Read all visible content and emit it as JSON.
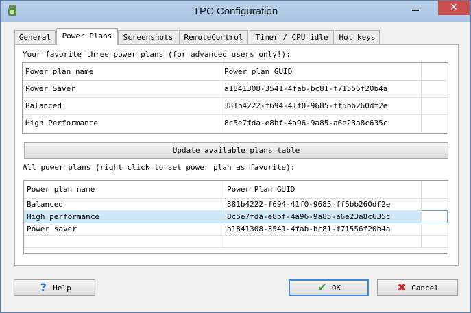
{
  "window": {
    "title": "TPC Configuration",
    "close_glyph": "✕"
  },
  "tabs": [
    {
      "label": "General"
    },
    {
      "label": "Power Plans"
    },
    {
      "label": "Screenshots"
    },
    {
      "label": "RemoteControl"
    },
    {
      "label": "Timer / CPU idle"
    },
    {
      "label": "Hot keys"
    }
  ],
  "favorites": {
    "caption": "Your favorite three power plans (for advanced users only!):",
    "headers": {
      "name": "Power plan name",
      "guid": "Power plan GUID"
    },
    "rows": [
      {
        "name": "Power Saver",
        "guid": "a1841308-3541-4fab-bc81-f71556f20b4a"
      },
      {
        "name": "Balanced",
        "guid": "381b4222-f694-41f0-9685-ff5bb260df2e"
      },
      {
        "name": "High Performance",
        "guid": "8c5e7fda-e8bf-4a96-9a85-a6e23a8c635c"
      }
    ]
  },
  "update_button": {
    "label": "Update available plans table"
  },
  "all_plans": {
    "caption": "All power plans (right click to set power plan as favorite):",
    "headers": {
      "name": "Power plan name",
      "guid": "Power Plan GUID"
    },
    "rows": [
      {
        "name": "Balanced",
        "guid": "381b4222-f694-41f0-9685-ff5bb260df2e"
      },
      {
        "name": "High performance",
        "guid": "8c5e7fda-e8bf-4a96-9a85-a6e23a8c635c",
        "selected": true
      },
      {
        "name": "Power saver",
        "guid": "a1841308-3541-4fab-bc81-f71556f20b4a"
      }
    ]
  },
  "buttons": {
    "help": "Help",
    "ok": "OK",
    "cancel": "Cancel"
  },
  "icons": {
    "help": "help-icon",
    "ok": "check-icon",
    "cancel": "close-icon"
  }
}
